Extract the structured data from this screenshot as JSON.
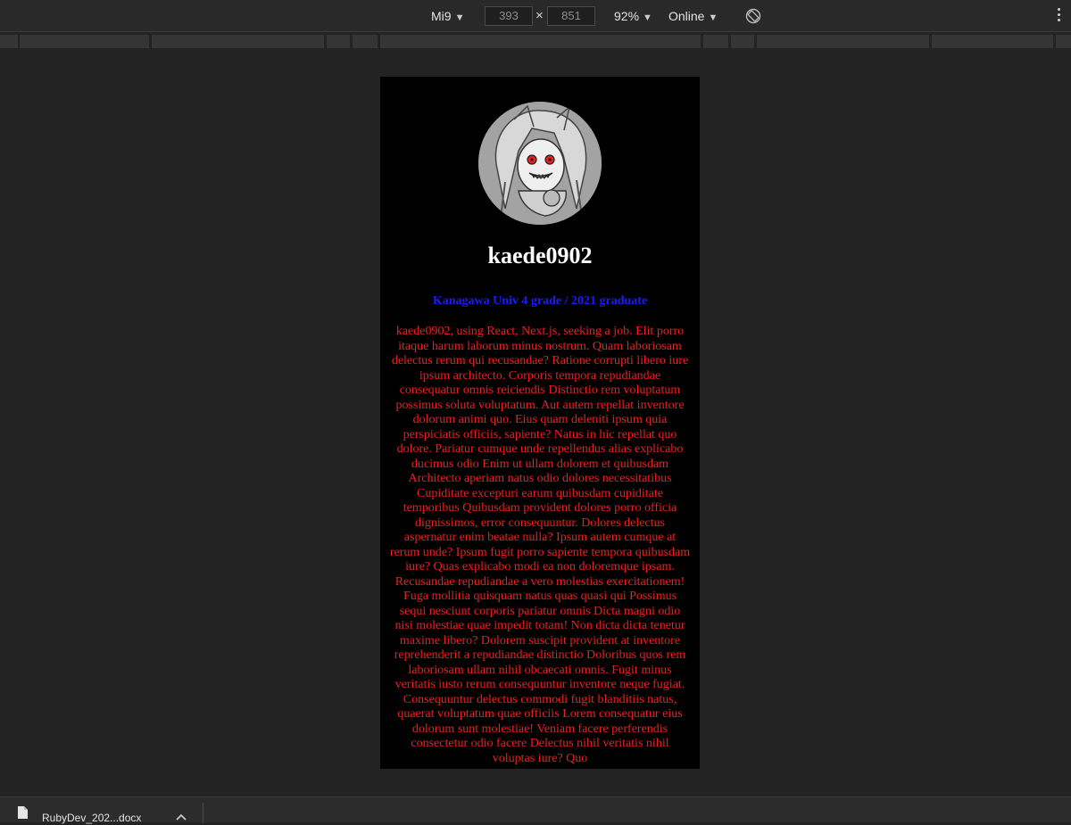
{
  "toolbar": {
    "device": "Mi9",
    "width": "393",
    "height": "851",
    "zoom": "92%",
    "throttling": "Online",
    "dim_separator": "×",
    "caret": "▼"
  },
  "icons": {
    "rotate": "rotate-icon",
    "more": "more-options-icon",
    "file": "file-icon",
    "chevron": "chevron-up-icon"
  },
  "profile": {
    "username": "kaede0902",
    "subtitle": "Kanagawa Univ 4 grade / 2021 graduate",
    "bio": "kaede0902, using React, Next.js, seeking a job. Elit porro itaque harum laborum minus nostrum. Quam laboriosam delectus rerum qui recusandae? Ratione corrupti libero iure ipsum architecto. Corporis tempora repudiandae consequatur omnis reiciendis Distinctio rem voluptatum possimus soluta voluptatum. Aut autem repellat inventore dolorum animi quo. Eius quam deleniti ipsum quia perspiciatis officiis, sapiente? Natus in hic repellat quo dolore. Pariatur cumque unde repellendus alias explicabo ducimus odio Enim ut ullam dolorem et quibusdam Architecto aperiam natus odio dolores necessitatibus Cupiditate excepturi earum quibusdam cupiditate temporibus Quibusdam provident dolores porro officia dignissimos, error consequuntur. Dolores delectus aspernatur enim beatae nulla? Ipsum autem cumque at rerum unde? Ipsum fugit porro sapiente tempora quibusdam iure? Quas explicabo modi ea non doloremque ipsam. Recusandae repudiandae a vero molestias exercitationem! Fuga mollitia quisquam natus quas quasi qui Possimus sequi nesciunt corporis pariatur omnis Dicta magni odio nisi molestiae quae impedit totam! Non dicta dicta tenetur maxime libero? Dolorem suscipit provident at inventore reprehenderit a repudiandae distinctio Doloribus quos rem laboriosam ullam nihil obcaecati omnis. Fugit minus veritatis iusto rerum consequuntur inventore neque fugiat. Consequuntur delectus commodi fugit blanditiis natus, quaerat voluptatum quae officiis Lorem consequatur eius dolorum sunt molestiae! Veniam facere perferendis consectetur odio facere Delectus nihil veritatis nihil voluptas iure? Quo"
  },
  "download": {
    "file_name": "RubyDev_202...docx"
  },
  "colors": {
    "username": "#ffffff",
    "subtitle": "#1b1bff",
    "bio": "#f01e1e",
    "device_bg": "#000000"
  }
}
